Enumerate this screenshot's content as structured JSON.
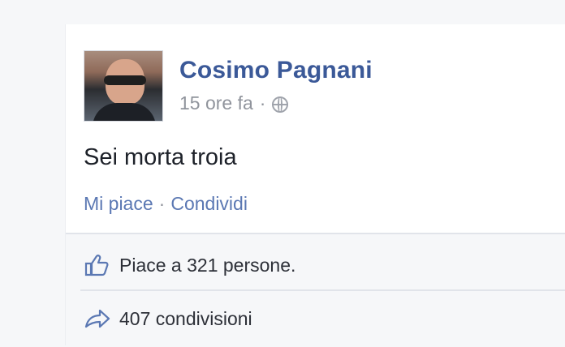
{
  "post": {
    "author_name": "Cosimo Pagnani",
    "timestamp": "15 ore fa",
    "meta_separator": "·",
    "privacy_icon": "globe-icon",
    "text": "Sei morta troia",
    "actions": {
      "like_label": "Mi piace",
      "separator": "·",
      "share_label": "Condividi"
    }
  },
  "footer": {
    "likes_text": "Piace a 321 persone.",
    "shares_text": "407 condivisioni",
    "like_icon": "thumbs-up-icon",
    "share_icon": "share-arrow-icon"
  },
  "colors": {
    "link": "#3b5998",
    "muted": "#90949c",
    "text": "#1d2129",
    "footer_bg": "#f6f7f9"
  }
}
